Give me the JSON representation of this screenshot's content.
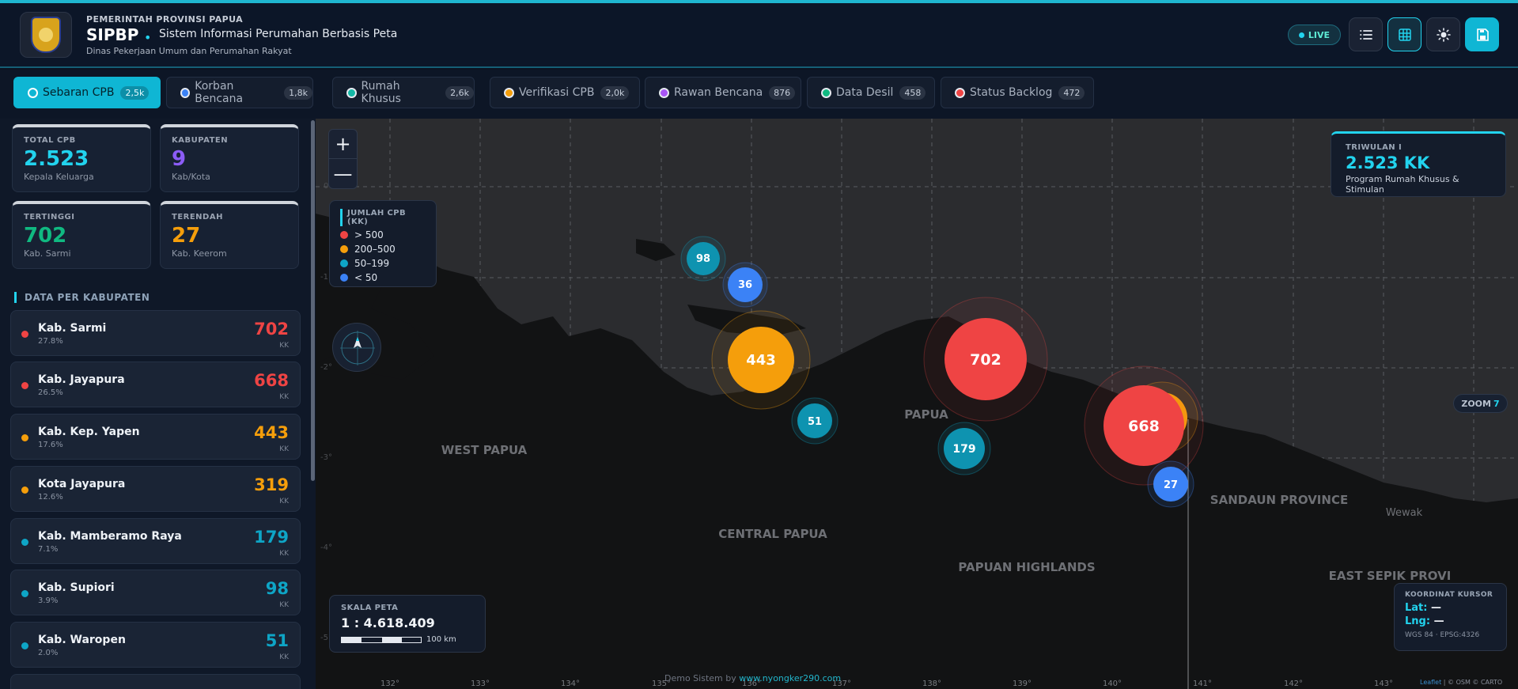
{
  "header": {
    "gov": "PEMERINTAH PROVINSI PAPUA",
    "app": "SIPBP",
    "app_name": "Sistem Informasi Perumahan Berbasis Peta",
    "dinas": "Dinas Pekerjaan Umum dan Perumahan Rakyat",
    "live": "LIVE",
    "buttons": [
      "list-icon",
      "grid-icon",
      "sun-icon",
      "save-icon"
    ]
  },
  "tabs": [
    {
      "label": "Sebaran CPB",
      "count": "2,5k",
      "color": "#ffffff"
    },
    {
      "label": "Korban Bencana",
      "count": "1,8k",
      "color": "#3b82f6"
    },
    {
      "label": "Rumah Khusus",
      "count": "2,6k",
      "color": "#14b8a6"
    },
    {
      "label": "Verifikasi CPB",
      "count": "2,0k",
      "color": "#f59e0b"
    },
    {
      "label": "Rawan Bencana",
      "count": "876",
      "color": "#a855f7"
    },
    {
      "label": "Data Desil",
      "count": "458",
      "color": "#10b981"
    },
    {
      "label": "Status Backlog",
      "count": "472",
      "color": "#ef4444"
    }
  ],
  "stats": [
    {
      "label": "TOTAL CPB",
      "value": "2.523",
      "sub": "Kepala Keluarga",
      "color": "#22d3ee"
    },
    {
      "label": "KABUPATEN",
      "value": "9",
      "sub": "Kab/Kota",
      "color": "#8b5cf6"
    },
    {
      "label": "TERTINGGI",
      "value": "702",
      "sub": "Kab. Sarmi",
      "color": "#10b981"
    },
    {
      "label": "TERENDAH",
      "value": "27",
      "sub": "Kab. Keerom",
      "color": "#f59e0b"
    }
  ],
  "section_title": "DATA PER KABUPATEN",
  "kabupaten": [
    {
      "name": "Kab. Sarmi",
      "pct": "27.8%",
      "value": "702",
      "unit": "KK",
      "color": "#ef4444"
    },
    {
      "name": "Kab. Jayapura",
      "pct": "26.5%",
      "value": "668",
      "unit": "KK",
      "color": "#ef4444"
    },
    {
      "name": "Kab. Kep. Yapen",
      "pct": "17.6%",
      "value": "443",
      "unit": "KK",
      "color": "#f59e0b"
    },
    {
      "name": "Kota Jayapura",
      "pct": "12.6%",
      "value": "319",
      "unit": "KK",
      "color": "#f59e0b"
    },
    {
      "name": "Kab. Mamberamo Raya",
      "pct": "7.1%",
      "value": "179",
      "unit": "KK",
      "color": "#0ea5c6"
    },
    {
      "name": "Kab. Supiori",
      "pct": "3.9%",
      "value": "98",
      "unit": "KK",
      "color": "#0ea5c6"
    },
    {
      "name": "Kab. Waropen",
      "pct": "2.0%",
      "value": "51",
      "unit": "KK",
      "color": "#0ea5c6"
    }
  ],
  "map": {
    "zoom_in": "+",
    "zoom_out": "—",
    "legend": {
      "title": "JUMLAH CPB (KK)",
      "items": [
        {
          "label": "> 500",
          "color": "#ef4444"
        },
        {
          "label": "200–500",
          "color": "#f59e0b"
        },
        {
          "label": "50–199",
          "color": "#0ea5c6"
        },
        {
          "label": "< 50",
          "color": "#3b82f6"
        }
      ]
    },
    "regions": [
      "WEST PAPUA",
      "PAPUA",
      "CENTRAL PAPUA",
      "PAPUAN HIGHLANDS",
      "SANDAUN PROVINCE",
      "EAST SEPIK PROVI",
      "Wewak"
    ],
    "lon_ticks": [
      "132°",
      "133°",
      "134°",
      "135°",
      "136°",
      "137°",
      "138°",
      "139°",
      "140°",
      "141°",
      "142°",
      "143°"
    ],
    "lat_ticks": [
      "0°",
      "-1°",
      "-2°",
      "-3°",
      "-4°",
      "-5°"
    ],
    "markers": [
      "98",
      "36",
      "443",
      "51",
      "702",
      "179",
      "668",
      "27"
    ],
    "scale": {
      "title": "SKALA PETA",
      "value": "1 : 4.618.409",
      "bar_label": "100 km"
    },
    "triwulan": {
      "label": "TRIWULAN I",
      "value": "2.523 KK",
      "sub": "Program Rumah Khusus & Stimulan"
    },
    "zoom": {
      "label": "ZOOM",
      "value": "7"
    },
    "coord": {
      "title": "KOORDINAT KURSOR",
      "lat_label": "Lat:",
      "lat": "—",
      "lng_label": "Lng:",
      "lng": "—",
      "crs": "WGS 84 · EPSG:4326"
    },
    "credit": {
      "prefix": "Demo Sistem by",
      "link": "www.nyongker290.com"
    },
    "attribution": {
      "leaflet": "Leaflet",
      "rest": "| © OSM © CARTO"
    }
  }
}
